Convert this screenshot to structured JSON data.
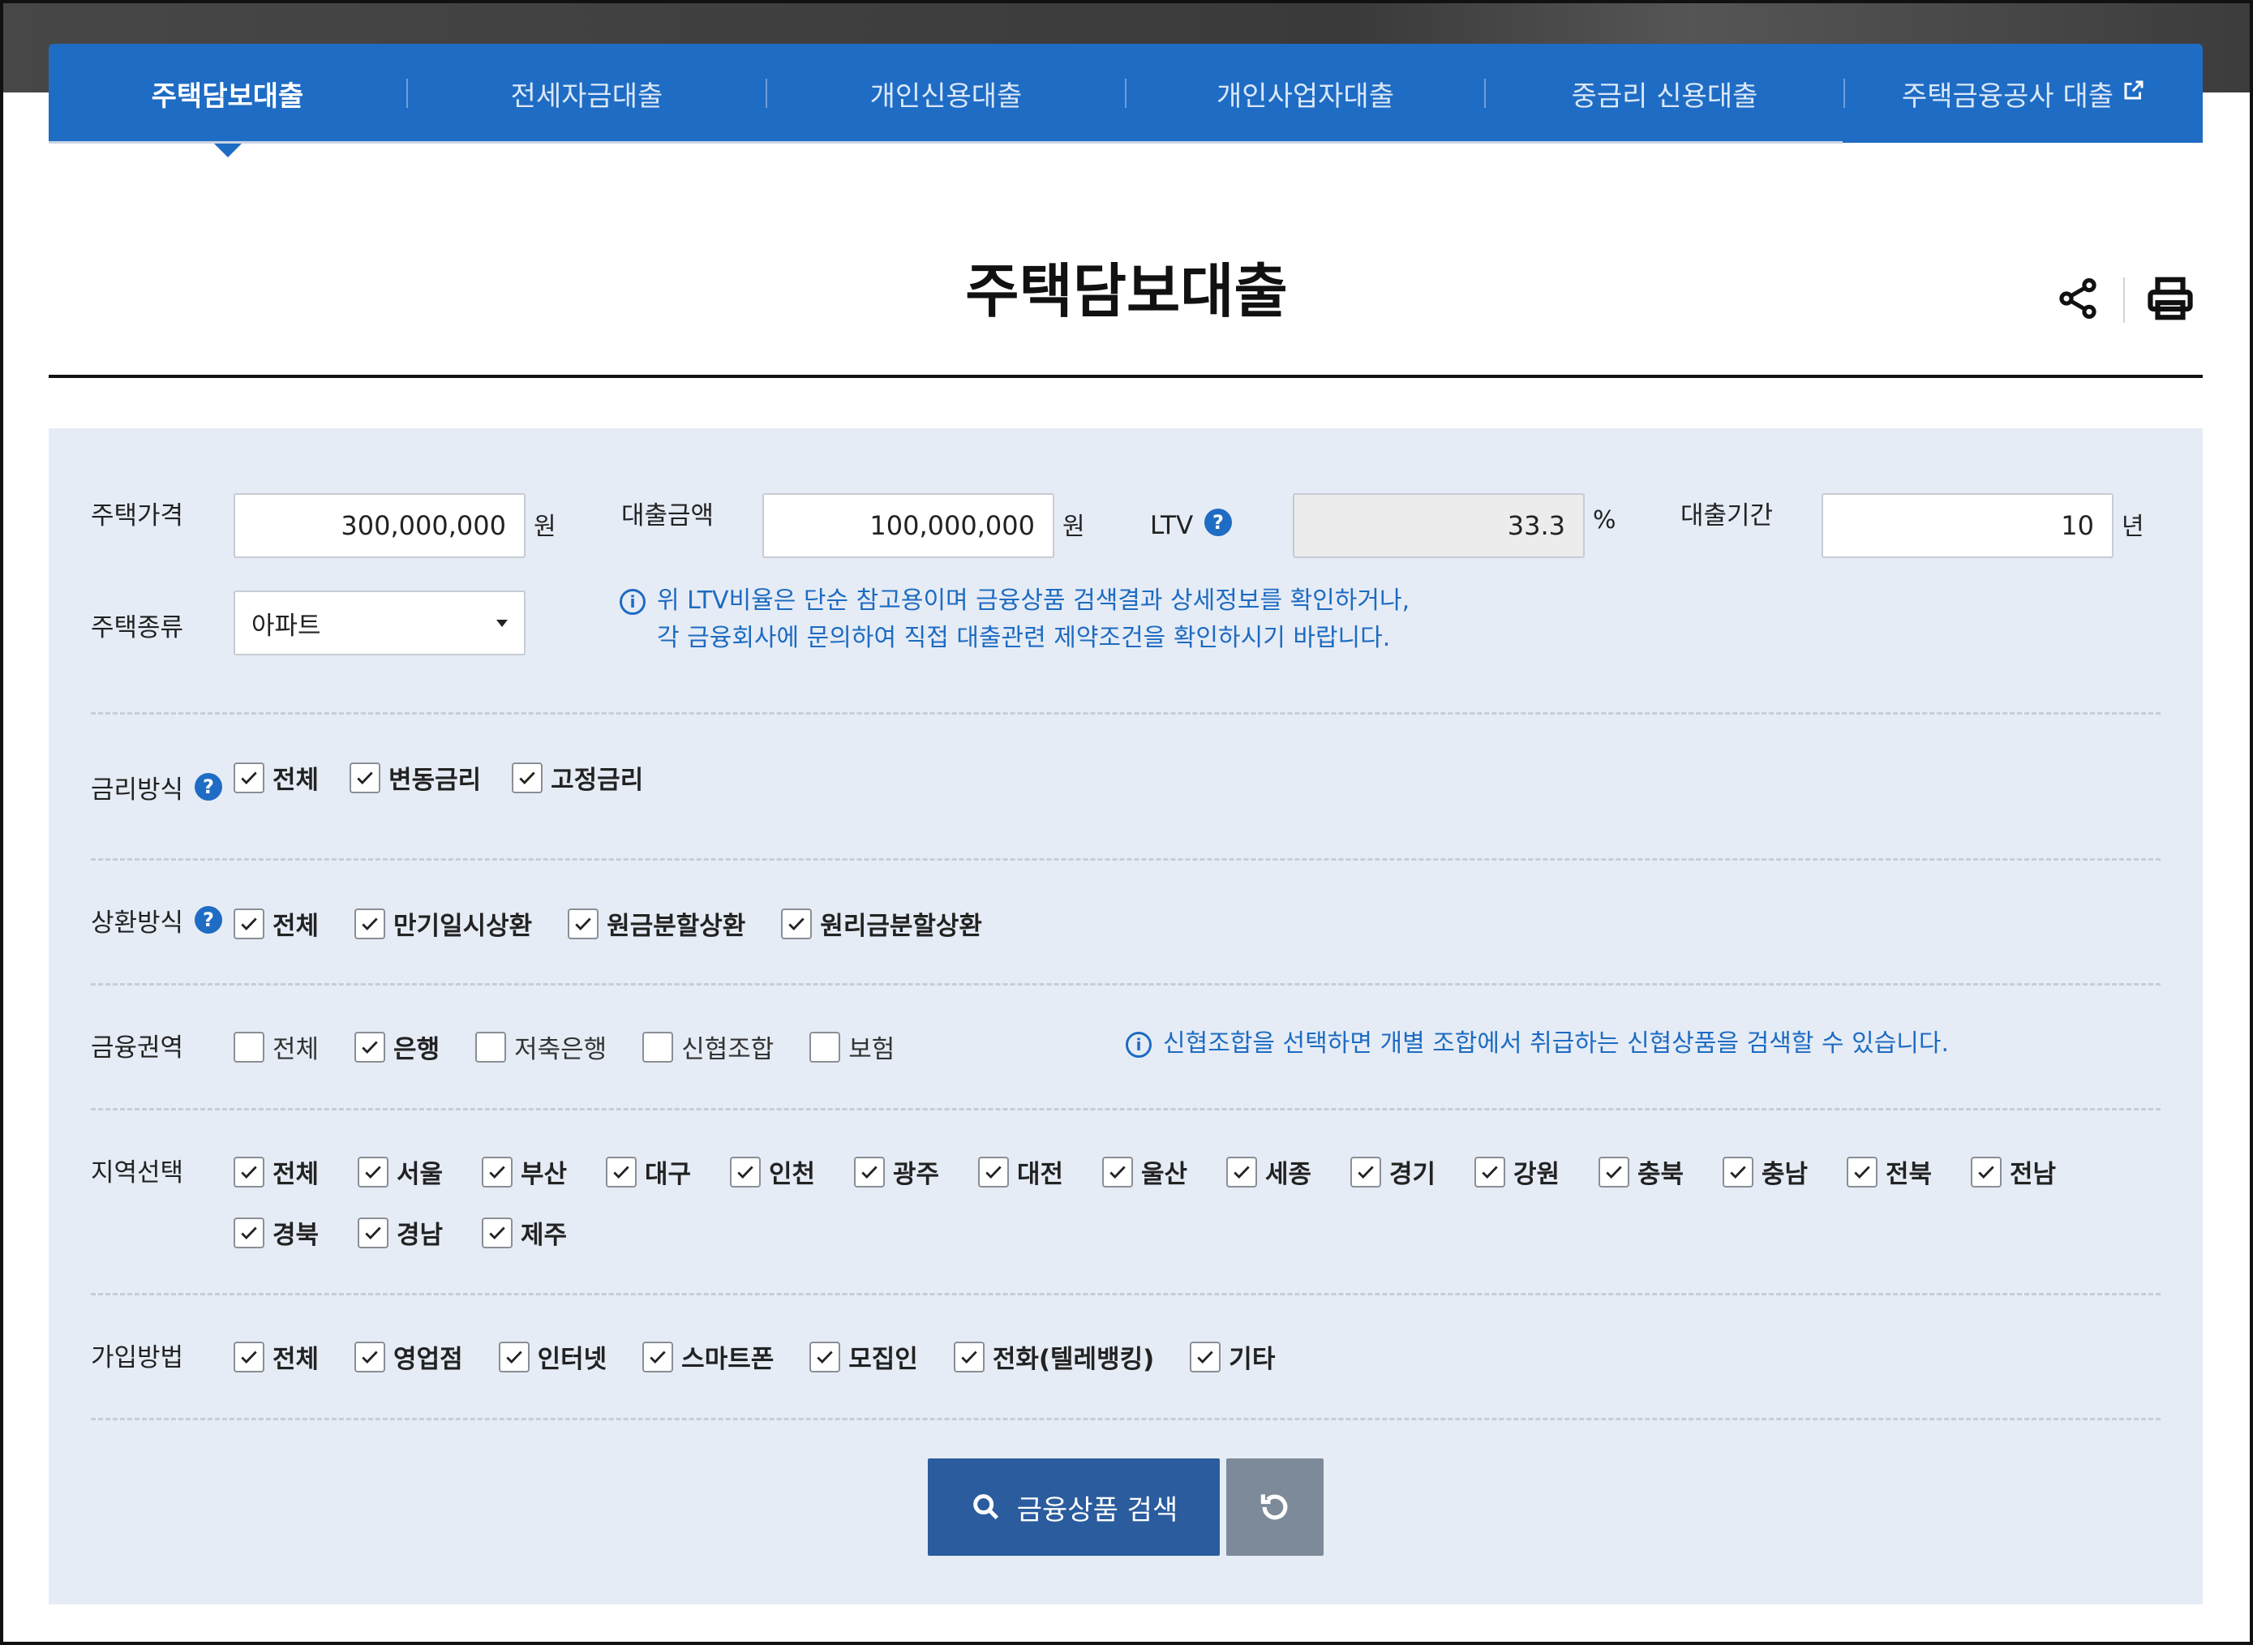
{
  "tabs": [
    {
      "label": "주택담보대출",
      "active": true
    },
    {
      "label": "전세자금대출",
      "active": false
    },
    {
      "label": "개인신용대출",
      "active": false
    },
    {
      "label": "개인사업자대출",
      "active": false
    },
    {
      "label": "중금리 신용대출",
      "active": false
    },
    {
      "label": "주택금융공사 대출",
      "active": false,
      "external": true
    }
  ],
  "title": "주택담보대출",
  "form": {
    "house_price": {
      "label": "주택가격",
      "value": "300,000,000",
      "unit": "원"
    },
    "loan_amount": {
      "label": "대출금액",
      "value": "100,000,000",
      "unit": "원"
    },
    "ltv": {
      "label": "LTV",
      "value": "33.3",
      "unit": "%"
    },
    "loan_period": {
      "label": "대출기간",
      "value": "10",
      "unit": "년"
    },
    "house_type": {
      "label": "주택종류",
      "selected": "아파트"
    },
    "ltv_note_line1": "위 LTV비율은 단순 참고용이며 금융상품 검색결과 상세정보를 확인하거나,",
    "ltv_note_line2": "각 금융회사에 문의하여 직접 대출관련 제약조건을 확인하시기 바랍니다."
  },
  "filters": {
    "rate_type": {
      "label": "금리방식",
      "options": [
        {
          "label": "전체",
          "checked": true
        },
        {
          "label": "변동금리",
          "checked": true
        },
        {
          "label": "고정금리",
          "checked": true
        }
      ]
    },
    "repayment": {
      "label": "상환방식",
      "options": [
        {
          "label": "전체",
          "checked": true
        },
        {
          "label": "만기일시상환",
          "checked": true
        },
        {
          "label": "원금분할상환",
          "checked": true
        },
        {
          "label": "원리금분할상환",
          "checked": true
        }
      ]
    },
    "sector": {
      "label": "금융권역",
      "options": [
        {
          "label": "전체",
          "checked": false
        },
        {
          "label": "은행",
          "checked": true
        },
        {
          "label": "저축은행",
          "checked": false
        },
        {
          "label": "신협조합",
          "checked": false
        },
        {
          "label": "보험",
          "checked": false
        }
      ],
      "note": "신협조합을 선택하면 개별 조합에서 취급하는 신협상품을 검색할 수 있습니다."
    },
    "region": {
      "label": "지역선택",
      "options": [
        {
          "label": "전체",
          "checked": true
        },
        {
          "label": "서울",
          "checked": true
        },
        {
          "label": "부산",
          "checked": true
        },
        {
          "label": "대구",
          "checked": true
        },
        {
          "label": "인천",
          "checked": true
        },
        {
          "label": "광주",
          "checked": true
        },
        {
          "label": "대전",
          "checked": true
        },
        {
          "label": "울산",
          "checked": true
        },
        {
          "label": "세종",
          "checked": true
        },
        {
          "label": "경기",
          "checked": true
        },
        {
          "label": "강원",
          "checked": true
        },
        {
          "label": "충북",
          "checked": true
        },
        {
          "label": "충남",
          "checked": true
        },
        {
          "label": "전북",
          "checked": true
        },
        {
          "label": "전남",
          "checked": true
        },
        {
          "label": "경북",
          "checked": true
        },
        {
          "label": "경남",
          "checked": true
        },
        {
          "label": "제주",
          "checked": true
        }
      ]
    },
    "join": {
      "label": "가입방법",
      "options": [
        {
          "label": "전체",
          "checked": true
        },
        {
          "label": "영업점",
          "checked": true
        },
        {
          "label": "인터넷",
          "checked": true
        },
        {
          "label": "스마트폰",
          "checked": true
        },
        {
          "label": "모집인",
          "checked": true
        },
        {
          "label": "전화(텔레뱅킹)",
          "checked": true
        },
        {
          "label": "기타",
          "checked": true
        }
      ]
    }
  },
  "buttons": {
    "search_label": "금융상품 검색",
    "reset_icon": "refresh-icon"
  },
  "colors": {
    "tab_bar": "#1f6cc4",
    "panel_bg": "#e6ecf5",
    "note_text": "#1d6bc2",
    "search_button": "#2a5c9e",
    "reset_button": "#7d8a99"
  }
}
